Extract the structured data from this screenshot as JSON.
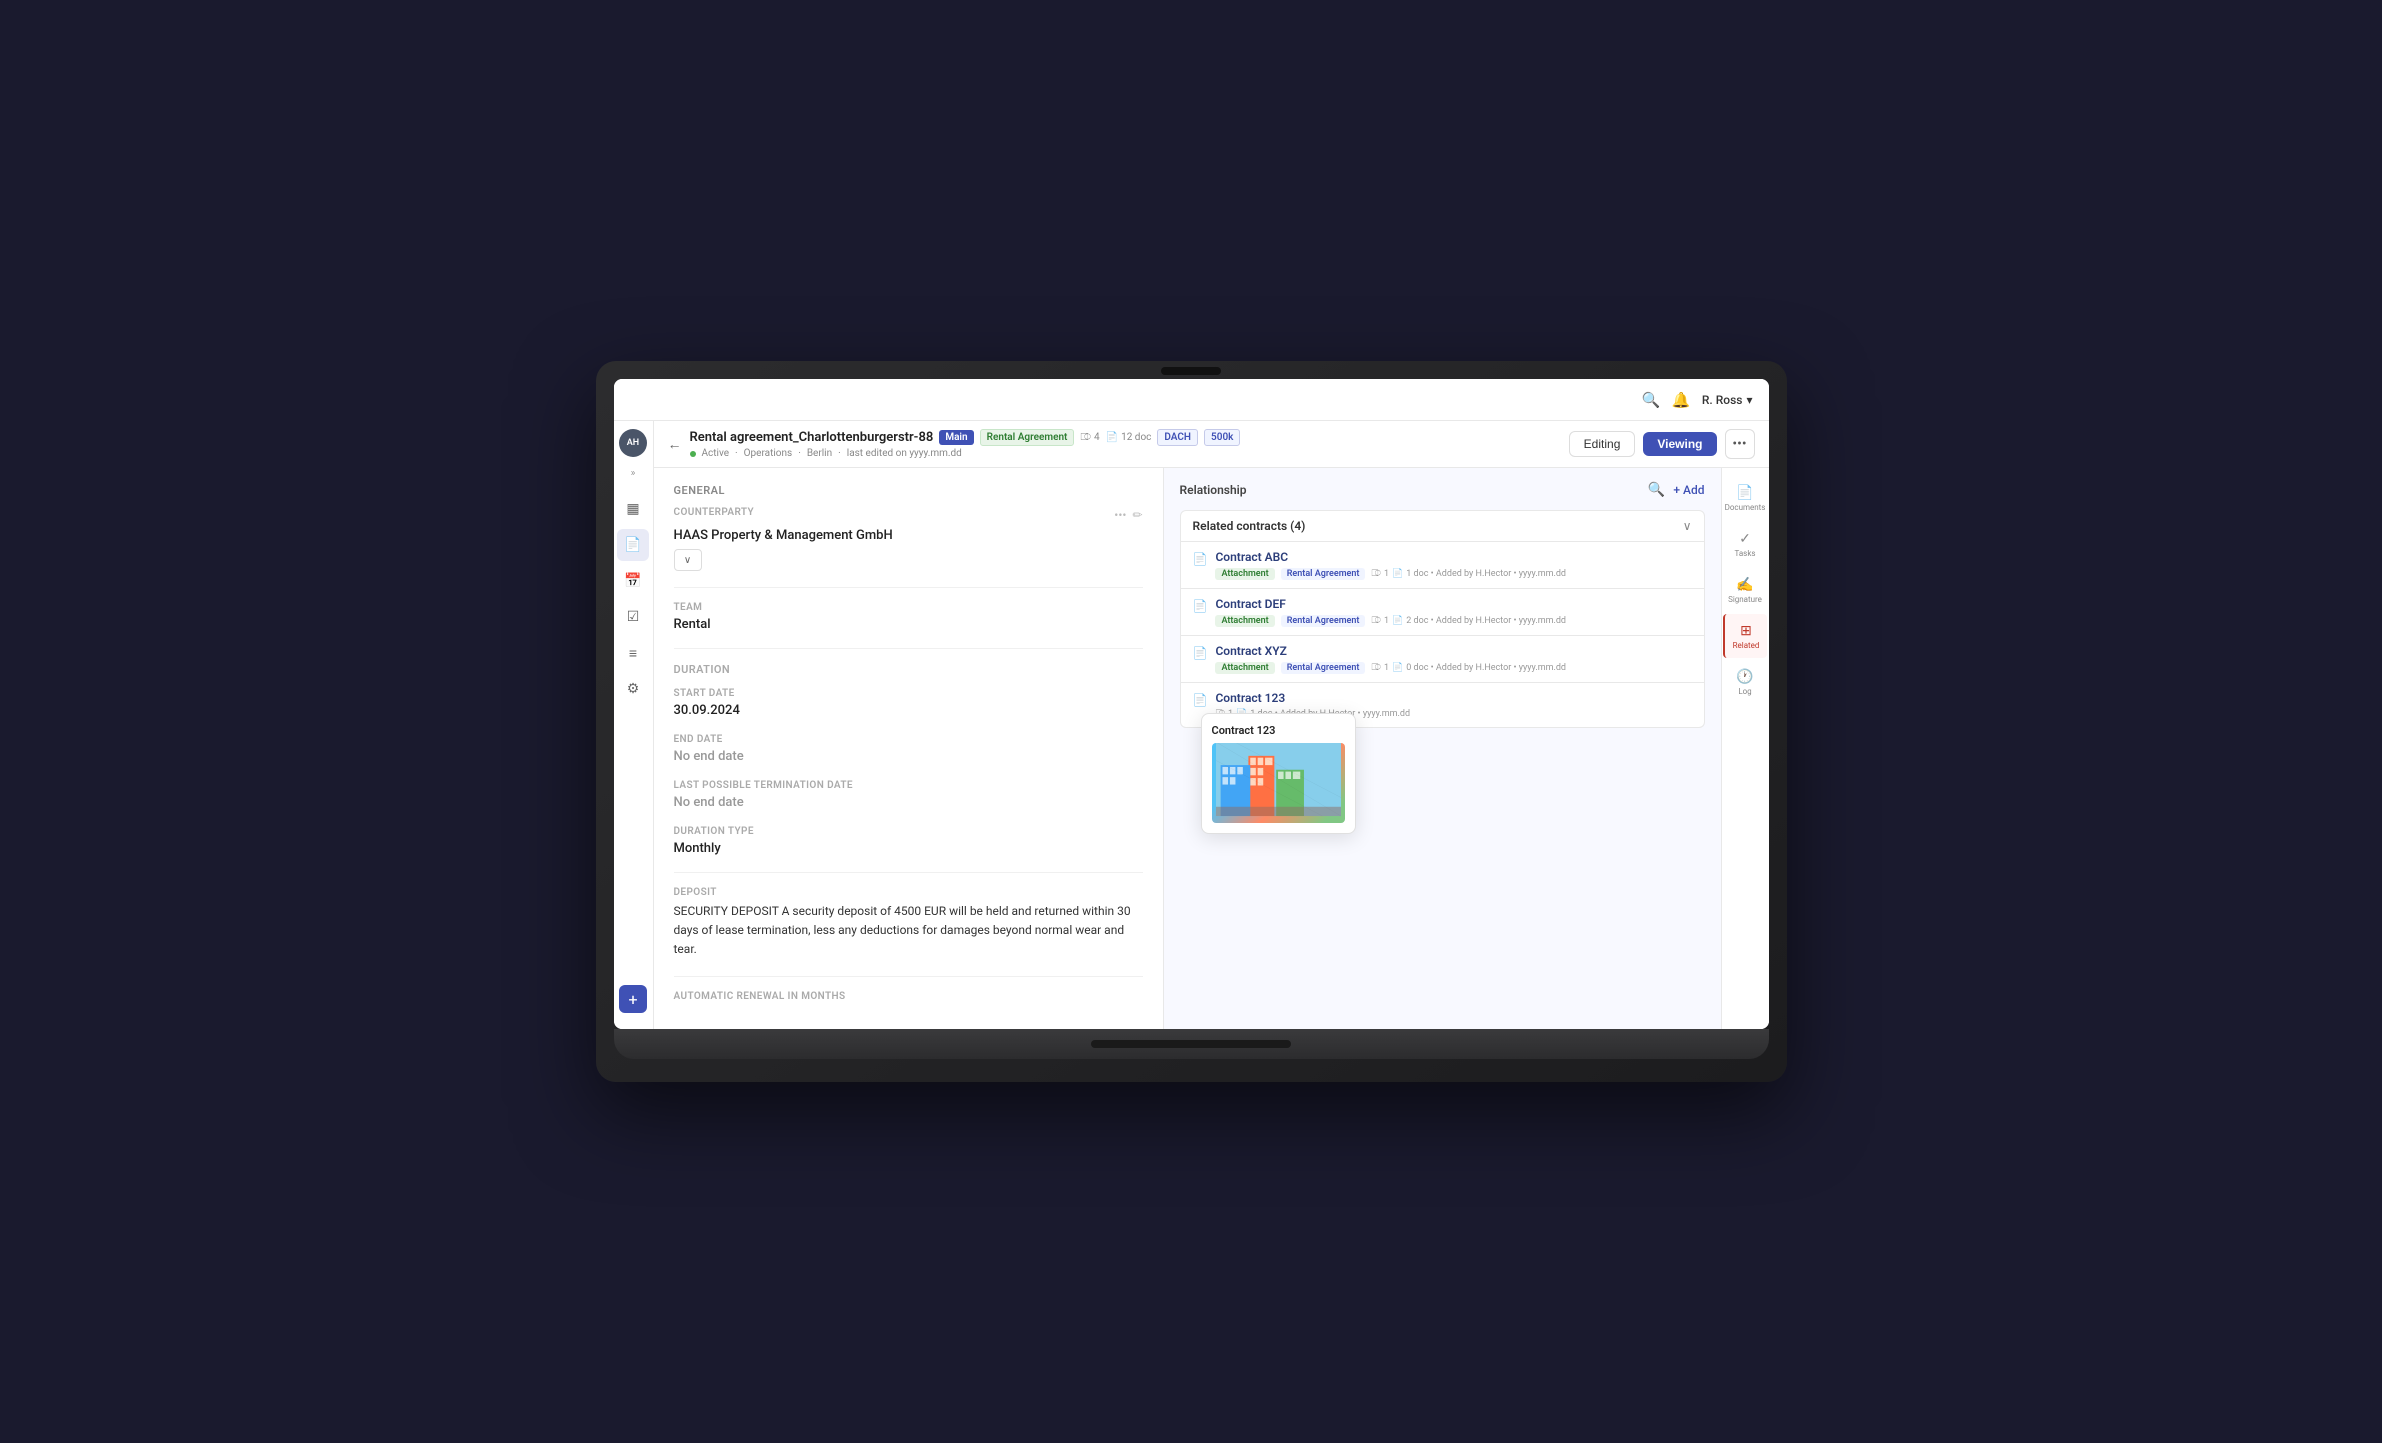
{
  "topnav": {
    "search_icon": "🔍",
    "bell_icon": "🔔",
    "user_name": "R. Ross",
    "chevron_icon": "▾"
  },
  "left_sidebar": {
    "avatar_text": "AH",
    "expand_icon": "»",
    "nav_items": [
      {
        "name": "layout-icon",
        "icon": "▦",
        "active": false
      },
      {
        "name": "file-icon",
        "icon": "📄",
        "active": false
      },
      {
        "name": "calendar-icon",
        "icon": "📅",
        "active": false
      },
      {
        "name": "check-icon",
        "icon": "☑",
        "active": false
      },
      {
        "name": "list-icon",
        "icon": "≡",
        "active": false
      },
      {
        "name": "settings-icon",
        "icon": "⚙",
        "active": false
      }
    ],
    "add_label": "+"
  },
  "contract_header": {
    "back_icon": "←",
    "title": "Rental agreement_Charlottenburgerstr-88",
    "badge_main": "Main",
    "badge_type": "Rental Agreement",
    "link_icon": "⎄",
    "link_count": "4",
    "doc_icon": "📄",
    "doc_count": "12 doc",
    "tag1": "DACH",
    "tag2": "500k",
    "status_label": "Active",
    "team_label": "Operations",
    "location_label": "Berlin",
    "last_edited": "last edited on yyyy.mm.dd",
    "btn_editing": "Editing",
    "btn_viewing": "Viewing",
    "more_icon": "•••"
  },
  "general_panel": {
    "section_title": "General",
    "counterparty_label": "COUNTERPARTY",
    "counterparty_value": "HAAS Property & Management GmbH",
    "dropdown_icon": "∨",
    "team_label": "TEAM",
    "team_value": "Rental",
    "duration_label": "Duration",
    "start_date_label": "START DATE",
    "start_date_value": "30.09.2024",
    "end_date_label": "END DATE",
    "end_date_value": "No end date",
    "termination_label": "LAST POSSIBLE TERMINATION DATE",
    "termination_value": "No end date",
    "duration_type_label": "DURATION TYPE",
    "duration_type_value": "Monthly",
    "deposit_label": "DEPOSIT",
    "deposit_value": "SECURITY DEPOSIT A security deposit of 4500 EUR will be held and returned within 30 days of lease termination, less any deductions for damages beyond normal wear and tear.",
    "auto_renewal_label": "AUTOMATIC RENEWAL IN MONTHS"
  },
  "relationship_panel": {
    "title": "Relationship",
    "search_icon": "🔍",
    "add_icon": "+",
    "add_label": "Add",
    "related_title": "Related contracts (4)",
    "collapse_icon": "∨",
    "contracts": [
      {
        "name": "Contract ABC",
        "icon": "📄",
        "tag1": "Attachment",
        "tag2": "Rental Agreement",
        "link_count": "1",
        "doc_count": "1 doc",
        "added_by": "Added by H.Hector",
        "date": "yyyy.mm.dd",
        "has_tooltip": false
      },
      {
        "name": "Contract DEF",
        "icon": "📄",
        "tag1": "Attachment",
        "tag2": "Rental Agreement",
        "link_count": "1",
        "doc_count": "2 doc",
        "added_by": "Added by H.Hector",
        "date": "yyyy.mm.dd",
        "has_tooltip": false
      },
      {
        "name": "Contract XYZ",
        "icon": "📄",
        "tag1": "Attachment",
        "tag2": "Rental Agreement",
        "link_count": "1",
        "doc_count": "0 doc",
        "added_by": "Added by H.Hector",
        "date": "yyyy.mm.dd",
        "has_tooltip": false
      },
      {
        "name": "Contract 123",
        "icon": "📄",
        "tag1": "",
        "tag2": "",
        "link_count": "1",
        "doc_count": "1 doc",
        "added_by": "Added by H.Hector",
        "date": "yyyy.mm.dd",
        "has_tooltip": true,
        "tooltip_title": "Contract 123"
      }
    ]
  },
  "right_sidebar": {
    "items": [
      {
        "name": "documents",
        "icon": "📄",
        "label": "Documents"
      },
      {
        "name": "tasks",
        "icon": "✓",
        "label": "Tasks"
      },
      {
        "name": "signature",
        "icon": "✍",
        "label": "Signature"
      },
      {
        "name": "related",
        "icon": "⊞",
        "label": "Related",
        "active": true
      },
      {
        "name": "log",
        "icon": "🕐",
        "label": "Log"
      }
    ]
  }
}
